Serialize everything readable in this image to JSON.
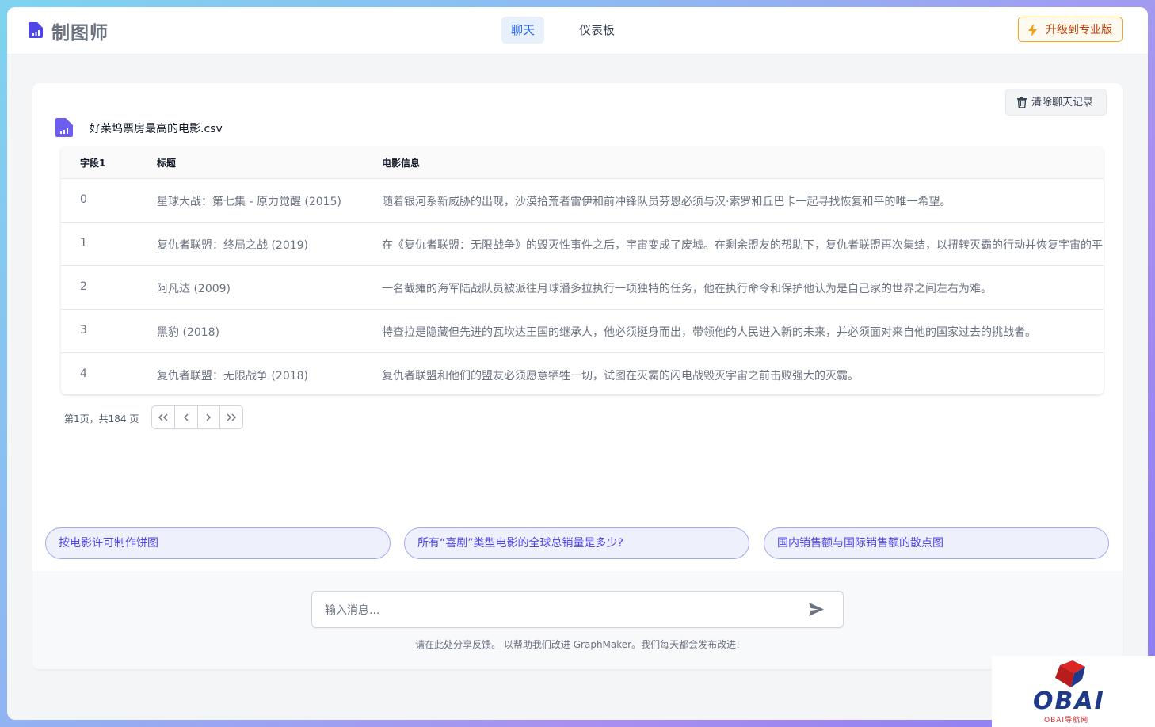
{
  "header": {
    "brand": "制图师",
    "tabs": [
      {
        "label": "聊天",
        "active": true
      },
      {
        "label": "仪表板",
        "active": false
      }
    ],
    "upgrade_label": "升级到专业版"
  },
  "chat": {
    "clear_label": "清除聊天记录",
    "file_name": "好莱坞票房最高的电影.csv",
    "table": {
      "headers": [
        "字段1",
        "标题",
        "电影信息"
      ],
      "rows": [
        [
          "0",
          "星球大战：第七集 - 原力觉醒 (2015)",
          "随着银河系新威胁的出现，沙漠拾荒者雷伊和前冲锋队员芬恩必须与汉·索罗和丘巴卡一起寻找恢复和平的唯一希望。"
        ],
        [
          "1",
          "复仇者联盟：终局之战 (2019)",
          "在《复仇者联盟：无限战争》的毁灭性事件之后，宇宙变成了废墟。在剩余盟友的帮助下，复仇者联盟再次集结，以扭转灭霸的行动并恢复宇宙的平"
        ],
        [
          "2",
          "阿凡达 (2009)",
          "一名截瘫的海军陆战队员被派往月球潘多拉执行一项独特的任务，他在执行命令和保护他认为是自己家的世界之间左右为难。"
        ],
        [
          "3",
          "黑豹 (2018)",
          "特查拉是隐藏但先进的瓦坎达王国的继承人，他必须挺身而出，带领他的人民进入新的未来，并必须面对来自他的国家过去的挑战者。"
        ],
        [
          "4",
          "复仇者联盟：无限战争 (2018)",
          "复仇者联盟和他们的盟友必须愿意牺牲一切，试图在灭霸的闪电战毁灭宇宙之前击败强大的灭霸。"
        ]
      ]
    },
    "pagination": {
      "text": "第1页，共184 页"
    },
    "suggestions": [
      "按电影许可制作饼图",
      "所有“喜剧”类型电影的全球总销量是多少?",
      "国内销售额与国际销售额的散点图"
    ],
    "input_placeholder": "输入消息...",
    "feedback_link": "请在此处分享反馈。",
    "feedback_text": "以帮助我们改进 GraphMaker。我们每天都会发布改进!"
  },
  "watermark": {
    "text": "OBAI",
    "sub": "OBAI导航网"
  },
  "colors": {
    "accent": "#4f46e5",
    "upgrade": "#f5a524",
    "active_tab_bg": "#e7f0fb"
  }
}
